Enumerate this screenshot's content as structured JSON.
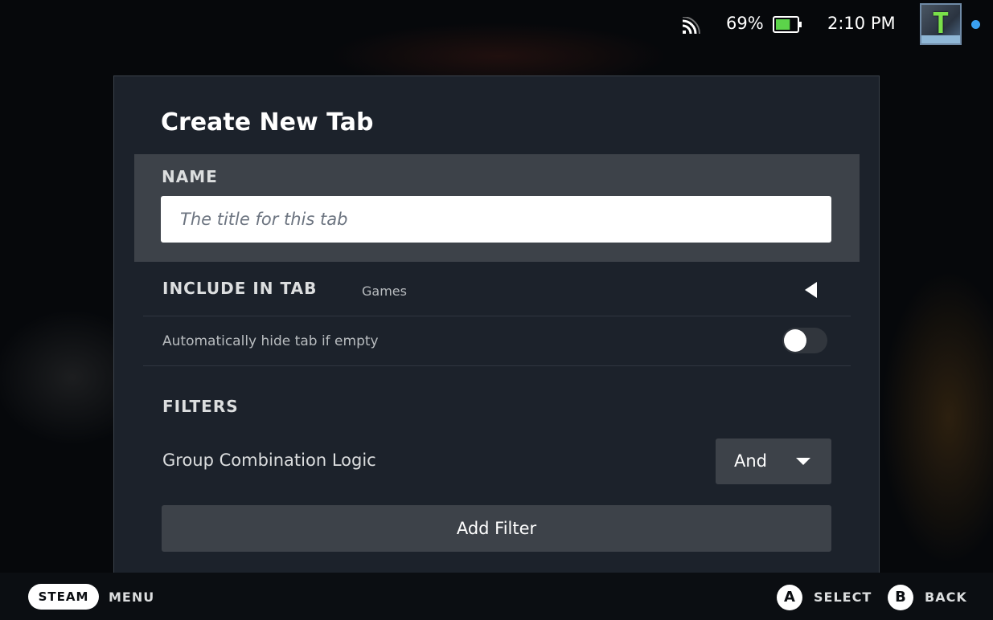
{
  "status_bar": {
    "battery_percent": "69%",
    "battery_level": 0.69,
    "time": "2:10 PM",
    "avatar_letter": "T",
    "icons": [
      "wifi-icon",
      "battery-icon",
      "notification-dot"
    ],
    "colors": {
      "battery_fill": "#5cd44a",
      "notify_dot": "#3aa0f0"
    }
  },
  "dialog": {
    "title": "Create New Tab",
    "name": {
      "label": "NAME",
      "placeholder": "The title for this tab",
      "value": ""
    },
    "include": {
      "label": "INCLUDE IN TAB",
      "value": "Games"
    },
    "autohide": {
      "label": "Automatically hide tab if empty",
      "enabled": false
    },
    "filters": {
      "label": "FILTERS",
      "group_logic_label": "Group Combination Logic",
      "group_logic_value": "And",
      "add_filter_label": "Add Filter"
    }
  },
  "footer": {
    "steam_label": "STEAM",
    "menu_label": "MENU",
    "a_glyph": "A",
    "select_label": "SELECT",
    "b_glyph": "B",
    "back_label": "BACK"
  }
}
